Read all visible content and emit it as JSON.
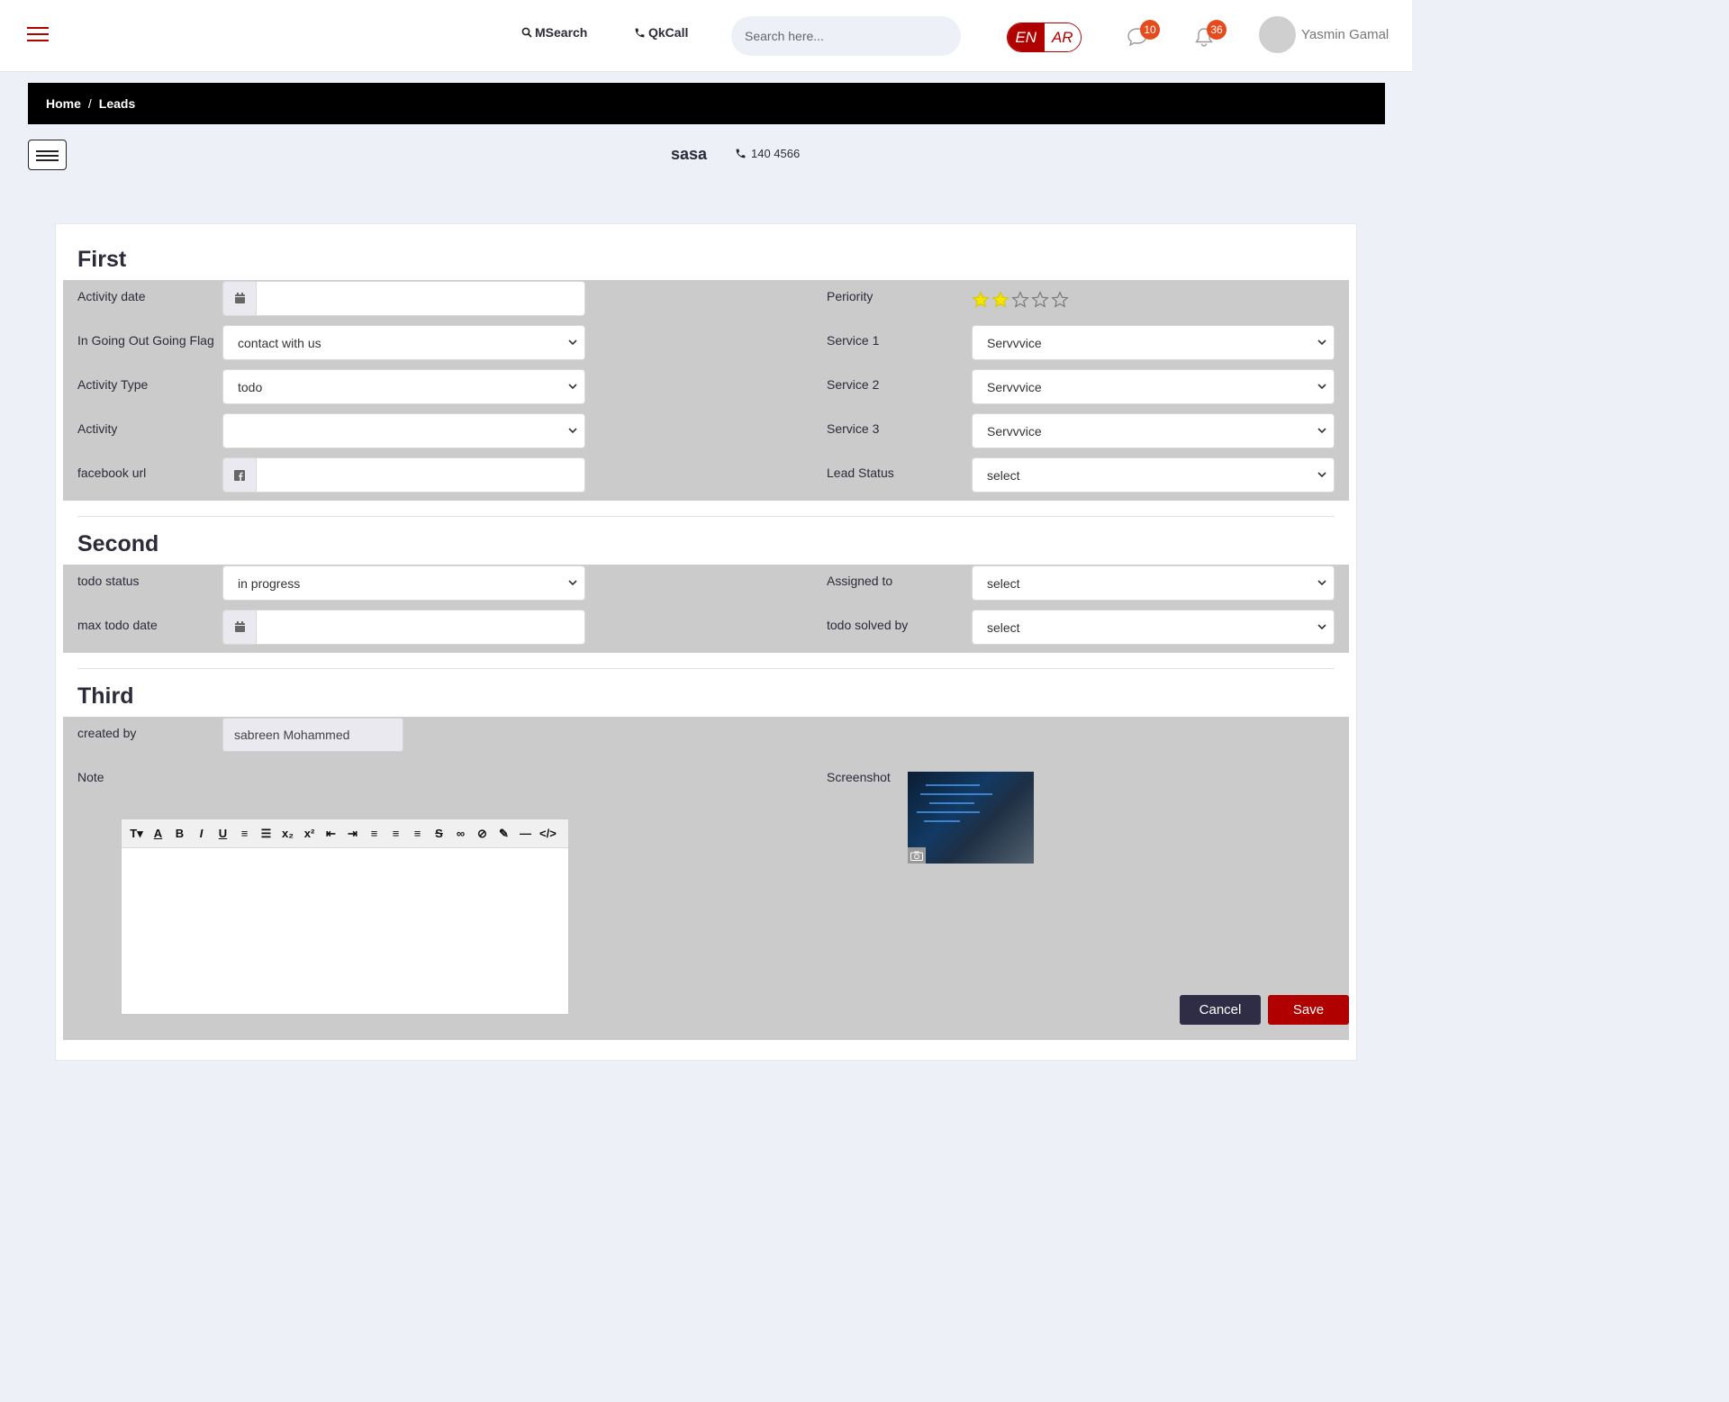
{
  "header": {
    "msearch_label": "MSearch",
    "qkcall_label": "QkCall",
    "search_placeholder": "Search here...",
    "lang_en": "EN",
    "lang_ar": "AR",
    "messages_count": "10",
    "notifications_count": "36",
    "user_name": "Yasmin Gamal",
    "accent_color": "#b00000"
  },
  "breadcrumb": {
    "home": "Home",
    "separator": "/",
    "current": "Leads"
  },
  "lead": {
    "name": "sasa",
    "phone": "140 4566"
  },
  "first": {
    "title": "First",
    "activity_date_label": "Activity date",
    "flag_label": "In Going Out Going Flag",
    "flag_value": "contact with us",
    "activity_type_label": "Activity Type",
    "activity_type_value": "todo",
    "activity_label": "Activity",
    "activity_value": "",
    "facebook_label": "facebook url",
    "priority_label": "Periority",
    "priority_rating": 2,
    "priority_max": 5,
    "service1_label": "Service 1",
    "service1_value": "Servvvice",
    "service2_label": "Service 2",
    "service2_value": "Servvvice",
    "service3_label": "Service 3",
    "service3_value": "Servvvice",
    "lead_status_label": "Lead Status",
    "lead_status_value": "select"
  },
  "second": {
    "title": "Second",
    "todo_status_label": "todo status",
    "todo_status_value": "in progress",
    "max_date_label": "max todo date",
    "assigned_label": "Assigned to",
    "assigned_value": "select",
    "solved_label": "todo solved by",
    "solved_value": "select"
  },
  "third": {
    "title": "Third",
    "created_by_label": "created by",
    "created_by_value": "sabreen Mohammed",
    "note_label": "Note",
    "screenshot_label": "Screenshot"
  },
  "actions": {
    "cancel": "Cancel",
    "save": "Save"
  }
}
